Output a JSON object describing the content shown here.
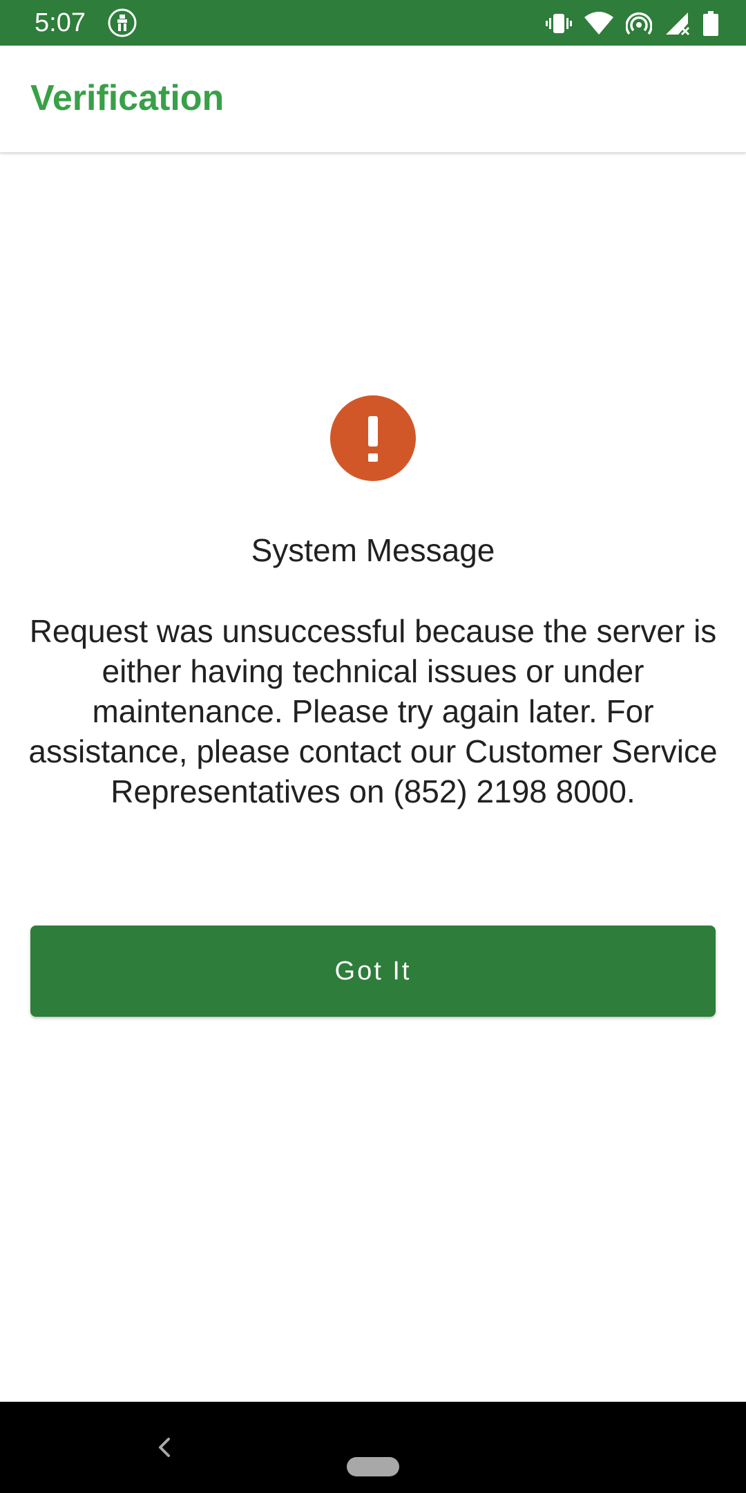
{
  "status_bar": {
    "time": "5:07",
    "app_icon": "bank-logo-icon",
    "icons": [
      "vibrate-icon",
      "wifi-icon",
      "hotspot-icon",
      "signal-icon",
      "battery-icon"
    ],
    "background_color": "#2e7d3a"
  },
  "app_bar": {
    "title": "Verification",
    "title_color": "#38a047"
  },
  "dialog": {
    "icon": "exclamation-icon",
    "icon_color": "#d25728",
    "title": "System Message",
    "body": "Request was unsuccessful because the server is either having technical issues or under maintenance. Please try again later. For assistance, please contact our Customer Service Representatives on (852) 2198 8000.",
    "button_label": "Got It",
    "button_color": "#2e7d3a"
  },
  "nav_bar": {
    "back_icon": "back-chevron-icon",
    "home_icon": "home-pill-icon"
  }
}
